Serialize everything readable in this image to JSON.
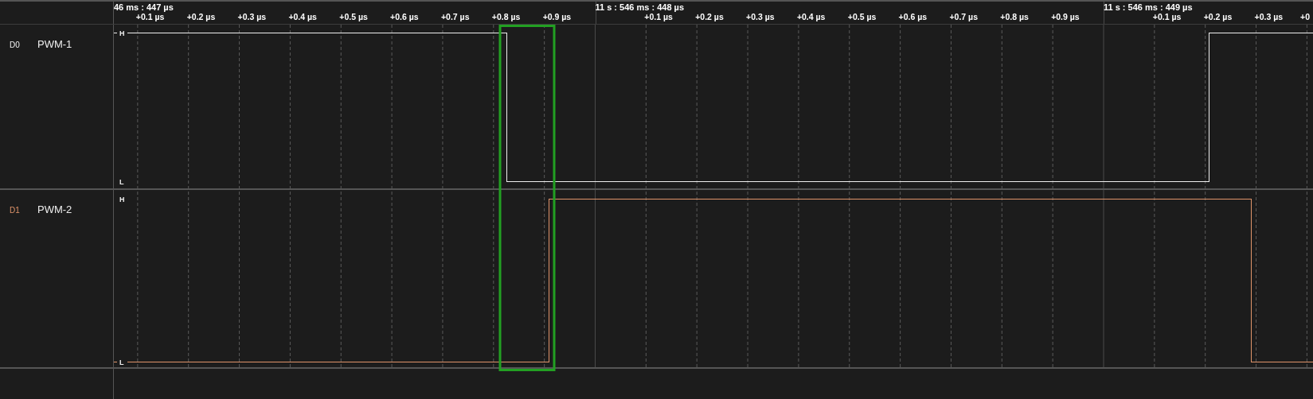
{
  "ruler": {
    "segments": [
      {
        "label": "46 ms : 447 µs",
        "ticks": [
          "+0.1 µs",
          "+0.2 µs",
          "+0.3 µs",
          "+0.4 µs",
          "+0.5 µs",
          "+0.6 µs",
          "+0.7 µs",
          "+0.8 µs",
          "+0.9 µs"
        ]
      },
      {
        "label": "11 s : 546 ms : 448 µs",
        "ticks": [
          "+0.1 µs",
          "+0.2 µs",
          "+0.3 µs",
          "+0.4 µs",
          "+0.5 µs",
          "+0.6 µs",
          "+0.7 µs",
          "+0.8 µs",
          "+0.9 µs"
        ]
      },
      {
        "label": "11 s : 546 ms : 449 µs",
        "ticks": [
          "+0.1 µs",
          "+0.2 µs",
          "+0.3 µs",
          "+0"
        ]
      }
    ]
  },
  "channels": [
    {
      "id": "D0",
      "name": "PWM-1",
      "color": "#f0f0f0",
      "high_label": "H",
      "low_label": "L"
    },
    {
      "id": "D1",
      "name": "PWM-2",
      "color": "#e0946a",
      "high_label": "H",
      "low_label": "L"
    }
  ]
}
